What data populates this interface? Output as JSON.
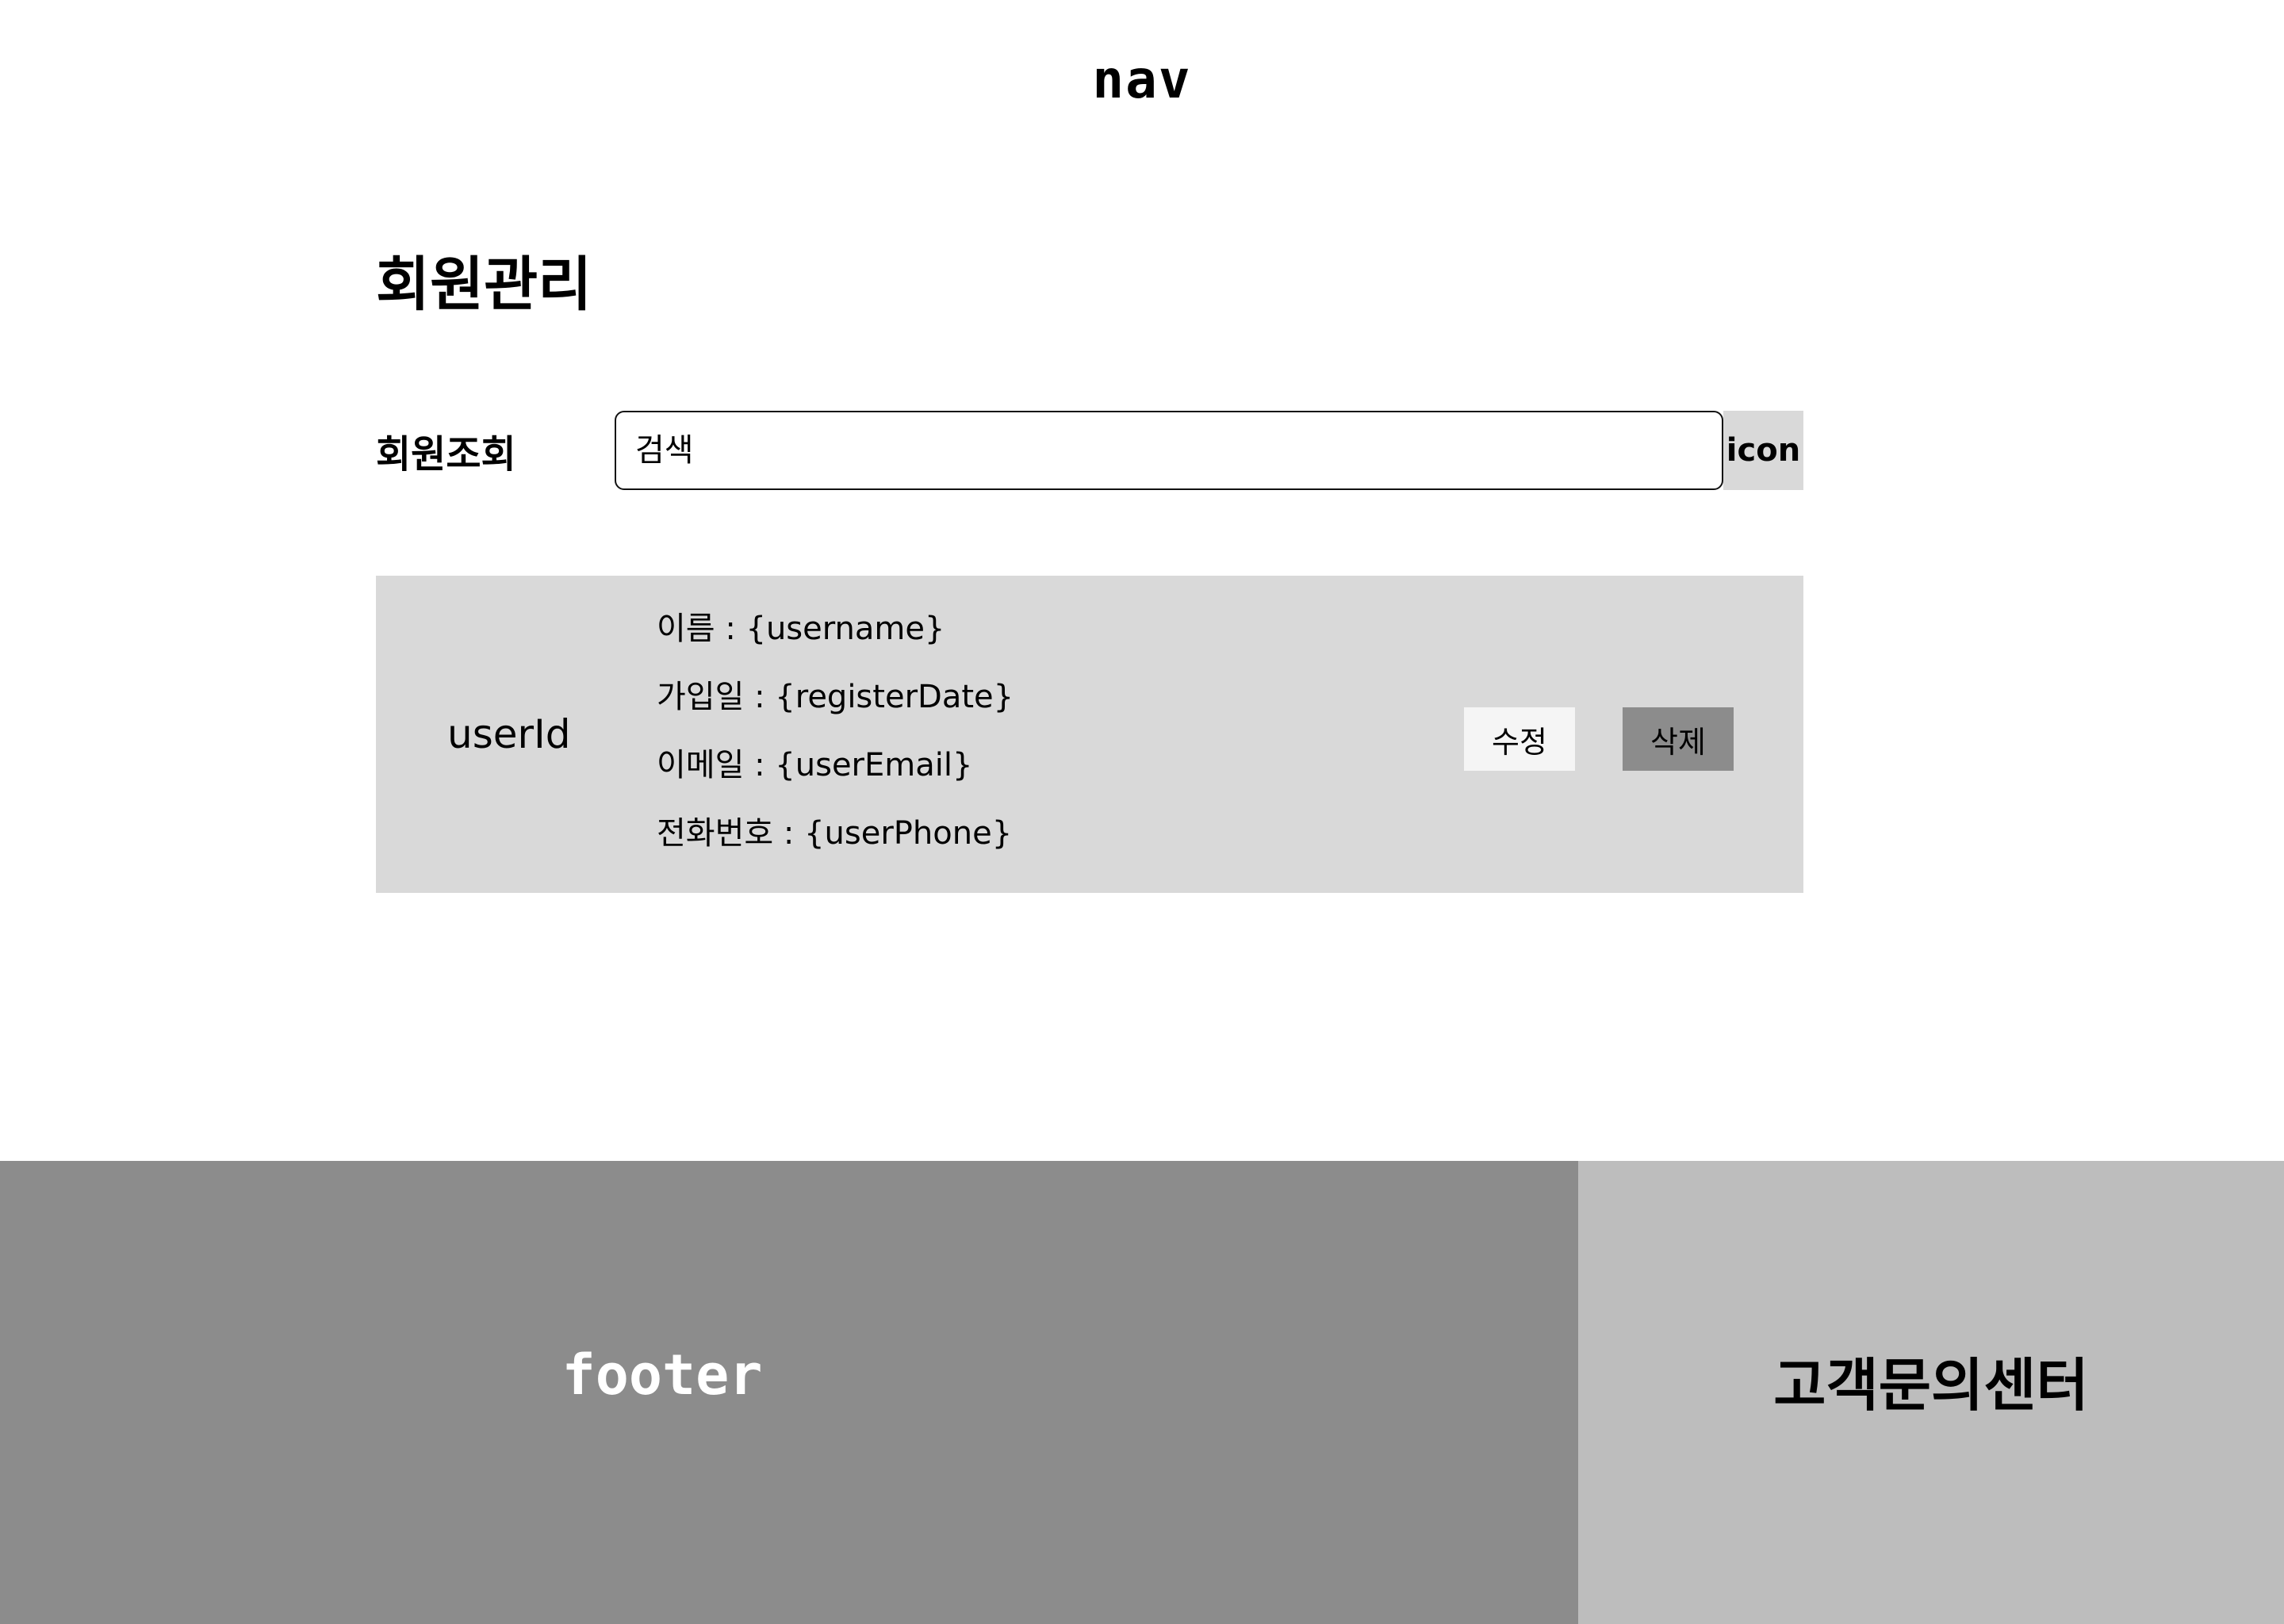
{
  "nav": {
    "label": "nav"
  },
  "page_title": "회원관리",
  "search": {
    "label": "회원조회",
    "placeholder": "검색",
    "icon_label": "icon"
  },
  "member_card": {
    "user_id": "userId",
    "details": [
      "이름 : {username}",
      "가입일 : {registerDate}",
      "이메일 : {userEmail}",
      "전화번호 : {userPhone}"
    ],
    "edit_label": "수정",
    "delete_label": "삭제"
  },
  "footer": {
    "label": "footer",
    "support_center_label": "고객문의센터"
  },
  "colors": {
    "card_background": "#d9d9d9",
    "edit_button": "#f5f5f5",
    "delete_button": "#8c8c8c",
    "footer_background": "#8c8c8c",
    "support_background": "#bdbdbd"
  }
}
